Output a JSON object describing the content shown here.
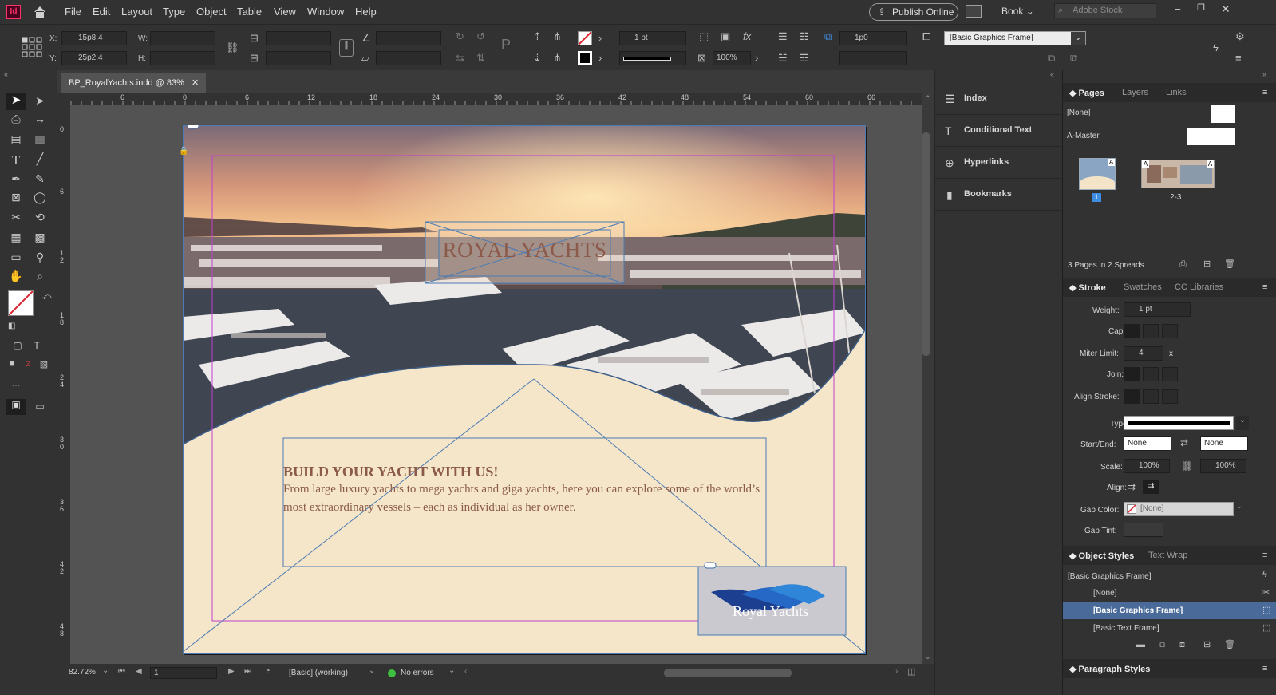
{
  "app": {
    "logo": "Id"
  },
  "menu": [
    "File",
    "Edit",
    "Layout",
    "Type",
    "Object",
    "Table",
    "View",
    "Window",
    "Help"
  ],
  "top_right": {
    "publish": "Publish Online",
    "workspace": "Book",
    "search_placeholder": "Adobe Stock"
  },
  "control": {
    "x_label": "X:",
    "x_value": "15p8.4",
    "y_label": "Y:",
    "y_value": "25p2.4",
    "w_label": "W:",
    "h_label": "H:",
    "stroke_weight": "1 pt",
    "scale": "100%",
    "offset": "1p0",
    "object_style": "[Basic Graphics Frame]"
  },
  "document_tab": {
    "title": "BP_RoyalYachts.indd @ 83%"
  },
  "ruler": {
    "h": [
      "6",
      "0",
      "6",
      "12",
      "18",
      "24",
      "30",
      "36",
      "42",
      "48",
      "54",
      "60",
      "66"
    ],
    "v": [
      "0",
      "6",
      "1 2",
      "1 8",
      "2 4",
      "3 0",
      "3 6",
      "4 2",
      "4 8"
    ]
  },
  "canvas": {
    "headline": "ROYAL YACHTS",
    "subheading": "BUILD YOUR YACHT WITH US!",
    "body": "From large luxury yachts to mega yachts and giga yachts, here you can explore some of the world’s most extraordinary vessels – each as individual as her owner.",
    "logo_text": "Royal Yachts",
    "colors": {
      "page_bg": "#f5e6c9",
      "text": "#8b5a4a",
      "frame": "#4a7bb4",
      "margin": "#c040d0"
    }
  },
  "status": {
    "zoom": "82.72%",
    "page": "1",
    "style": "[Basic] (working)",
    "errors": "No errors"
  },
  "mid_panel": [
    "Index",
    "Conditional Text",
    "Hyperlinks",
    "Bookmarks"
  ],
  "pages_panel": {
    "tabs": [
      "Pages",
      "Layers",
      "Links"
    ],
    "none_label": "[None]",
    "master_label": "A-Master",
    "page1": "1",
    "spread": "2-3",
    "summary": "3 Pages in 2 Spreads"
  },
  "stroke_panel": {
    "tabs": [
      "Stroke",
      "Swatches",
      "CC Libraries"
    ],
    "weight_label": "Weight:",
    "weight": "1 pt",
    "cap_label": "Cap:",
    "miter_label": "Miter Limit:",
    "miter": "4",
    "miter_unit": "x",
    "join_label": "Join:",
    "align_label": "Align Stroke:",
    "type_label": "Type:",
    "startend_label": "Start/End:",
    "start": "None",
    "end": "None",
    "scale_label": "Scale:",
    "scale_start": "100%",
    "scale_end": "100%",
    "align2_label": "Align:",
    "gap_color_label": "Gap Color:",
    "gap_color": "[None]",
    "gap_tint_label": "Gap Tint:"
  },
  "object_styles": {
    "tabs": [
      "Object Styles",
      "Text Wrap"
    ],
    "current": "[Basic Graphics Frame]",
    "items": [
      "[None]",
      "[Basic Graphics Frame]",
      "[Basic Text Frame]"
    ]
  },
  "paragraph_styles": {
    "title": "Paragraph Styles"
  }
}
